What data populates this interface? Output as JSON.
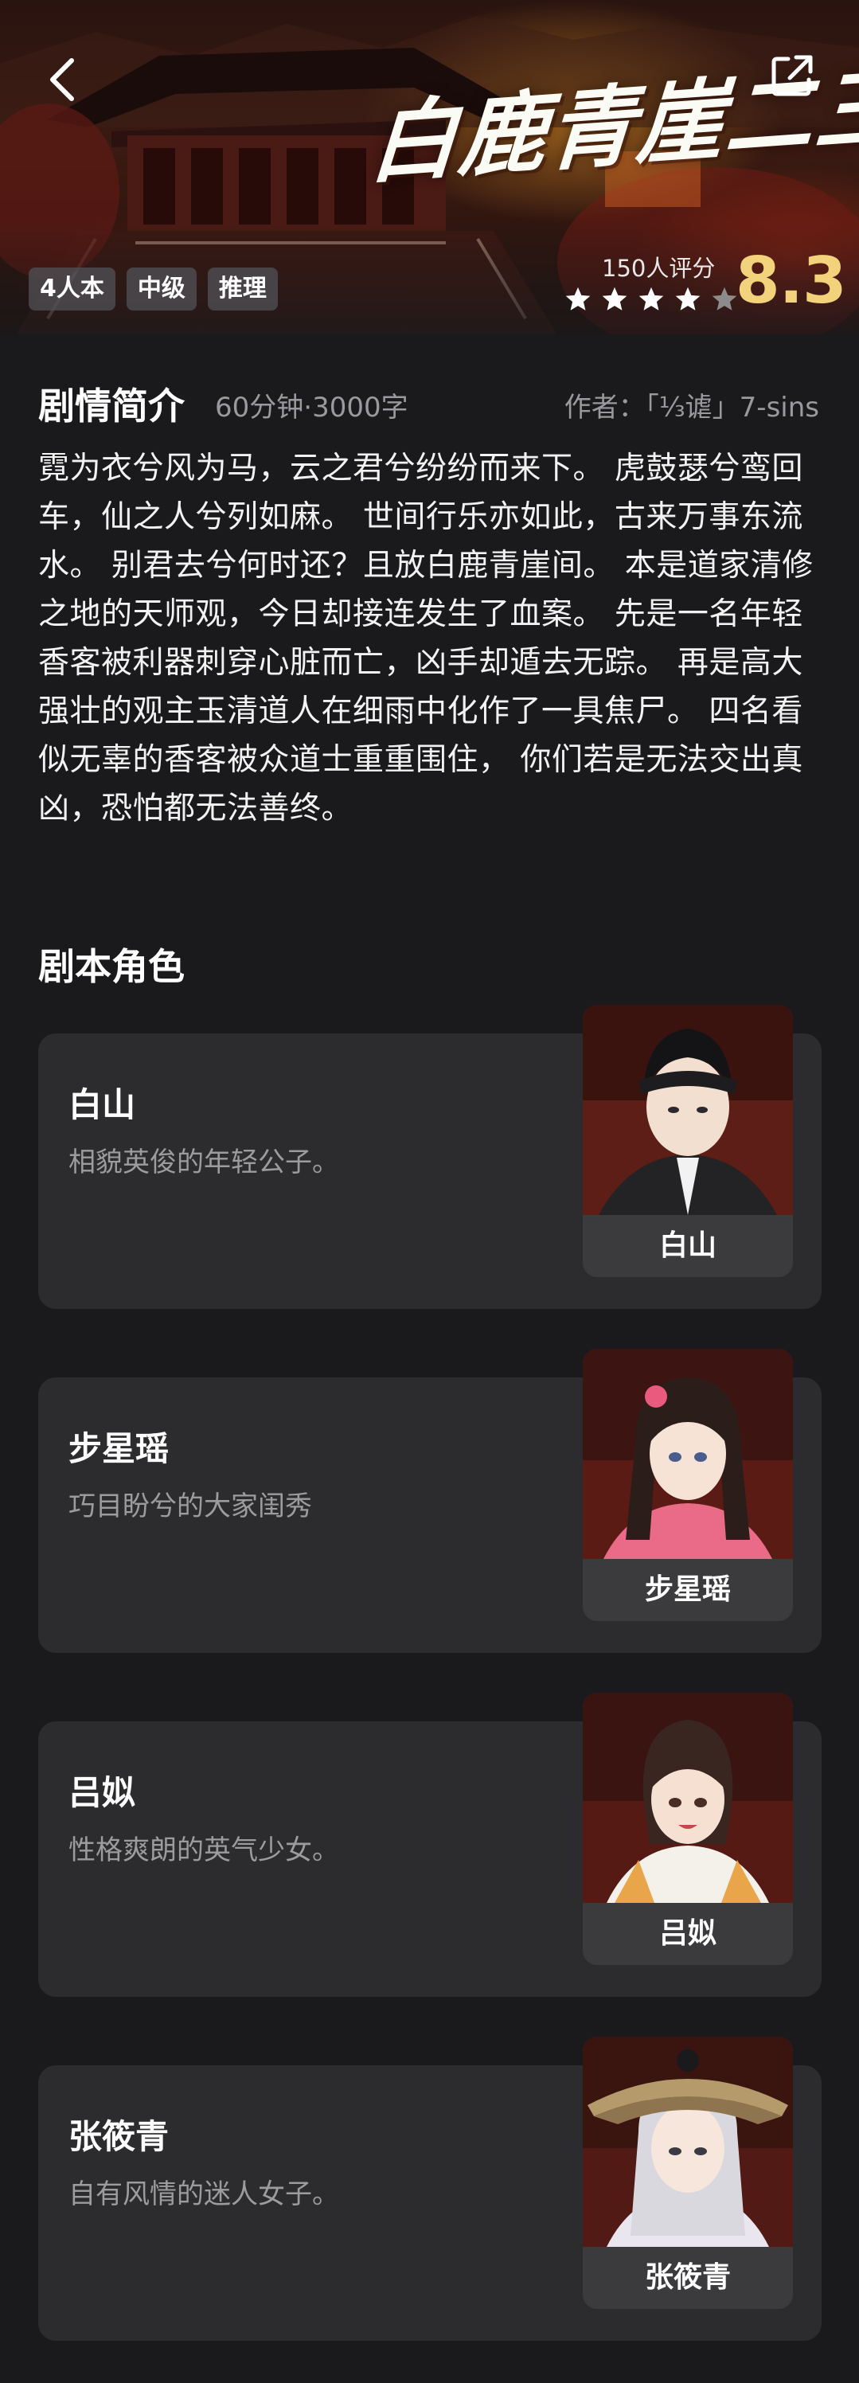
{
  "hero": {
    "title": "白鹿青崖二三事",
    "tags": [
      "4人本",
      "中级",
      "推理"
    ],
    "rating_count": "150人评分",
    "rating_score": "8.3",
    "stars": {
      "filled": 4,
      "total": 5,
      "filled_color": "#ffffff",
      "empty_color": "#8c8c8c"
    },
    "back_icon": "chevron-left-icon",
    "share_icon": "external-link-icon"
  },
  "synopsis": {
    "title": "剧情简介",
    "meta": "60分钟·3000字",
    "author": "作者：「⅓谑」7-sins",
    "text": "霓为衣兮风为马，云之君兮纷纷而来下。 虎鼓瑟兮鸾回车，仙之人兮列如麻。 世间行乐亦如此，古来万事东流水。 别君去兮何时还？且放白鹿青崖间。 本是道家清修之地的天师观，今日却接连发生了血案。 先是一名年轻香客被利器刺穿心脏而亡，凶手却遁去无踪。 再是高大强壮的观主玉清道人在细雨中化作了一具焦尸。 四名看似无辜的香客被众道士重重围住， 你们若是无法交出真凶，恐怕都无法善终。"
  },
  "roles": {
    "title": "剧本角色",
    "items": [
      {
        "name": "白山",
        "desc": "相貌英俊的年轻公子。",
        "portrait_label": "白山"
      },
      {
        "name": "步星瑶",
        "desc": "巧目盼兮的大家闺秀",
        "portrait_label": "步星瑶"
      },
      {
        "name": "吕姒",
        "desc": "性格爽朗的英气少女。",
        "portrait_label": "吕姒"
      },
      {
        "name": "张筱青",
        "desc": "自有风情的迷人女子。",
        "portrait_label": "张筱青"
      }
    ]
  },
  "colors": {
    "background": "#1a1a1c",
    "card": "#2c2c2e",
    "score": "#f2d27a",
    "muted_text": "#9a9a9e"
  }
}
